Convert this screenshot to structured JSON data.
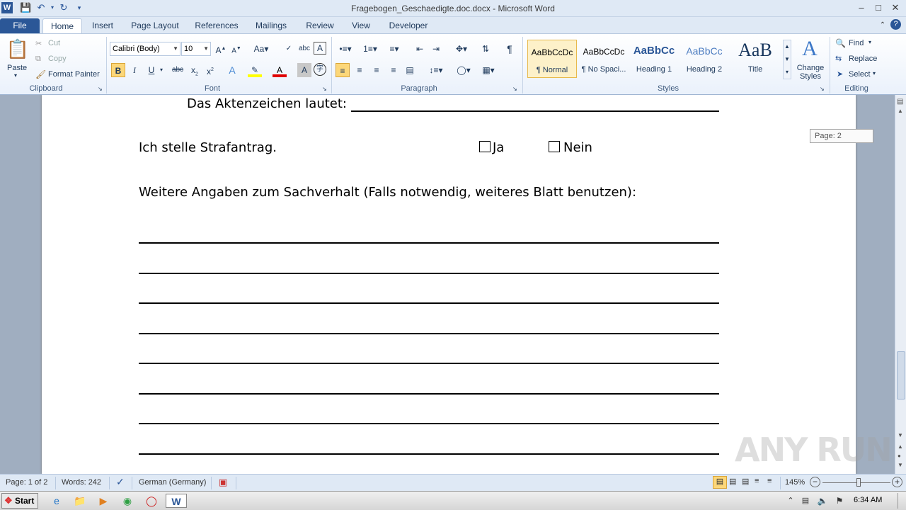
{
  "window": {
    "title": "Fragebogen_Geschaedigte.doc.docx - Microsoft Word"
  },
  "tabs": [
    "File",
    "Home",
    "Insert",
    "Page Layout",
    "References",
    "Mailings",
    "Review",
    "View",
    "Developer"
  ],
  "ribbon": {
    "clipboard": {
      "paste": "Paste",
      "cut": "Cut",
      "copy": "Copy",
      "format_painter": "Format Painter",
      "label": "Clipboard"
    },
    "font": {
      "name": "Calibri (Body)",
      "size": "10",
      "label": "Font"
    },
    "paragraph": {
      "label": "Paragraph"
    },
    "styles": {
      "label": "Styles",
      "items": [
        {
          "preview": "AaBbCcDc",
          "name": "¶ Normal"
        },
        {
          "preview": "AaBbCcDc",
          "name": "¶ No Spaci..."
        },
        {
          "preview": "AaBbCc",
          "name": "Heading 1"
        },
        {
          "preview": "AaBbCc",
          "name": "Heading 2"
        },
        {
          "preview": "AaB",
          "name": "Title"
        }
      ],
      "change_styles": "Change Styles"
    },
    "editing": {
      "find": "Find",
      "replace": "Replace",
      "select": "Select",
      "label": "Editing"
    }
  },
  "document": {
    "aktenzeichen": "Das Aktenzeichen lautet:",
    "strafantrag": "Ich stelle Strafantrag.",
    "ja": "Ja",
    "nein": "Nein",
    "weitere": "Weitere Angaben zum Sachverhalt (Falls notwendig, weiteres Blatt benutzen):"
  },
  "page_tooltip": "Page: 2",
  "statusbar": {
    "page": "Page: 1 of 2",
    "words": "Words: 242",
    "language": "German (Germany)",
    "zoom": "145%"
  },
  "taskbar": {
    "start": "Start",
    "clock": "6:34 AM"
  },
  "watermark": "ANY RUN"
}
